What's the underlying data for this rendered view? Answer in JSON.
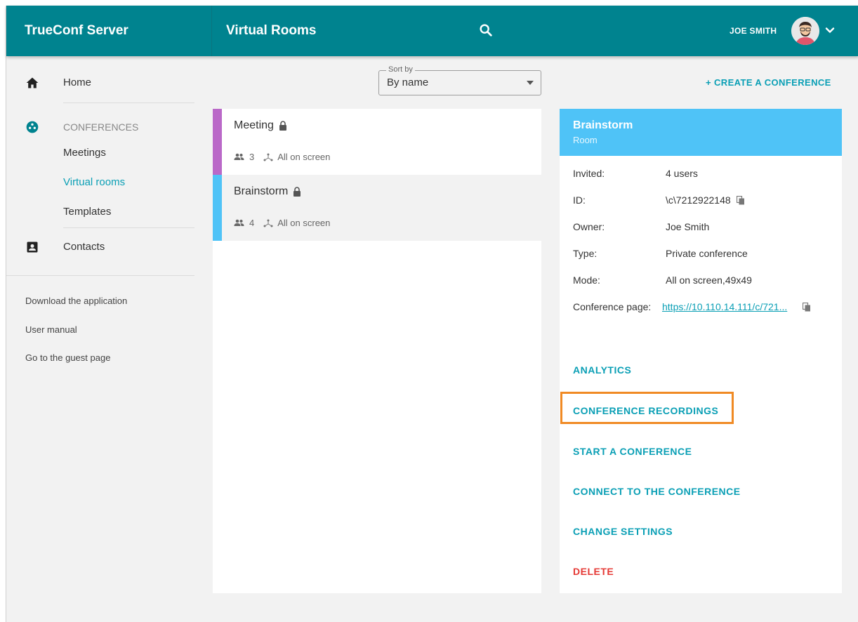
{
  "header": {
    "brand": "TrueConf Server",
    "page_title": "Virtual Rooms",
    "user_name": "JOE SMITH"
  },
  "sidebar": {
    "home_label": "Home",
    "conferences_label": "CONFERENCES",
    "conference_items": [
      "Meetings",
      "Virtual rooms",
      "Templates"
    ],
    "contacts_label": "Contacts",
    "links": [
      "Download the application",
      "User manual",
      "Go to the guest page"
    ]
  },
  "toolbar": {
    "sort_legend": "Sort by",
    "sort_value": "By name",
    "create_label": "+ CREATE A CONFERENCE"
  },
  "conferences": [
    {
      "name": "Meeting",
      "participants": "3",
      "mode": "All on screen",
      "stripe_color": "#ba68c8"
    },
    {
      "name": "Brainstorm",
      "participants": "4",
      "mode": "All on screen",
      "stripe_color": "#4fc3f7"
    }
  ],
  "detail": {
    "title": "Brainstorm",
    "subtitle": "Room",
    "fields": [
      {
        "label": "Invited:",
        "value": "4 users"
      },
      {
        "label": "ID:",
        "value": "\\c\\7212922148"
      },
      {
        "label": "Owner:",
        "value": "Joe Smith"
      },
      {
        "label": "Type:",
        "value": "Private conference"
      },
      {
        "label": "Mode:",
        "value": "All on screen,49x49"
      },
      {
        "label": "Conference page:",
        "value": "https://10.110.14.111/c/721..."
      }
    ],
    "actions": {
      "analytics": "ANALYTICS",
      "recordings": "CONFERENCE RECORDINGS",
      "start": "START A CONFERENCE",
      "connect": "CONNECT TO THE CONFERENCE",
      "settings": "CHANGE SETTINGS",
      "delete": "DELETE"
    }
  },
  "colors": {
    "header_bg": "#00838f",
    "accent": "#0a9fb5",
    "detail_head_bg": "#4fc3f7",
    "highlight": "#f08a24",
    "danger": "#e53935"
  },
  "icons": [
    "search-icon",
    "chevron-down-icon",
    "home-icon",
    "conferences-icon",
    "contacts-icon",
    "lock-icon",
    "participants-icon",
    "layout-icon",
    "copy-icon"
  ]
}
